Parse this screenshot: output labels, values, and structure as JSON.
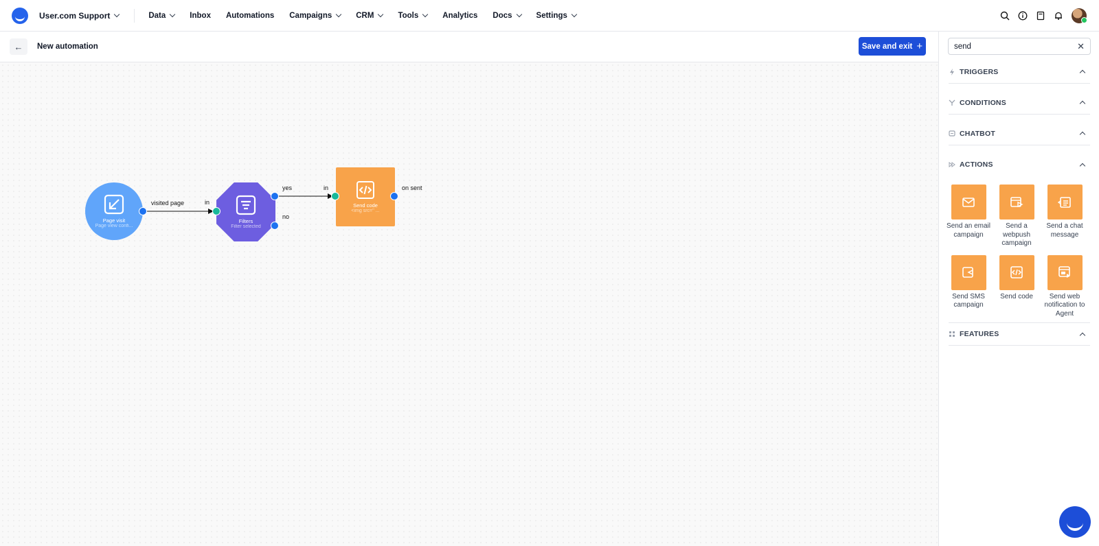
{
  "app": {
    "workspace": "User.com Support",
    "nav": [
      "Data",
      "Inbox",
      "Automations",
      "Campaigns",
      "CRM",
      "Tools",
      "Analytics",
      "Docs",
      "Settings"
    ],
    "right_icons": [
      "search-icon",
      "info-icon",
      "book-icon",
      "bell-icon",
      "avatar"
    ]
  },
  "header": {
    "back": "←",
    "title": "New automation",
    "save_label": "Save and exit",
    "save_plus": "+"
  },
  "flow": {
    "nodes": [
      {
        "id": "page-visit",
        "title": "Page visit",
        "subtitle": "Page view confi...",
        "color": "#60a5fa"
      },
      {
        "id": "filters",
        "title": "Filters",
        "subtitle": "Filter selected",
        "color": "#6d5ee0"
      },
      {
        "id": "send-code",
        "title": "Send code",
        "subtitle": "<img src='' ...",
        "color": "#f8a34a"
      }
    ],
    "edges": [
      {
        "from": "page-visit",
        "to": "filters",
        "label": "visited page",
        "in_label": "in"
      },
      {
        "from": "filters",
        "to": "send-code",
        "label": "yes",
        "in_label": "in"
      }
    ],
    "filters_no_label": "no",
    "send_code_out_label": "on sent"
  },
  "sidebar": {
    "search_value": "send",
    "clear": "✕",
    "sections": [
      {
        "name": "TRIGGERS",
        "icon": "lightning-icon"
      },
      {
        "name": "CONDITIONS",
        "icon": "branch-icon"
      },
      {
        "name": "CHATBOT",
        "icon": "chat-icon"
      },
      {
        "name": "ACTIONS",
        "icon": "fast-forward-icon"
      },
      {
        "name": "FEATURES",
        "icon": "grid-icon"
      }
    ],
    "actions": [
      {
        "label": "Send an email campaign",
        "icon": "email-icon"
      },
      {
        "label": "Send a webpush campaign",
        "icon": "webpush-icon"
      },
      {
        "label": "Send a chat message",
        "icon": "chat-message-icon"
      },
      {
        "label": "Send SMS campaign",
        "icon": "sms-icon"
      },
      {
        "label": "Send code",
        "icon": "code-icon"
      },
      {
        "label": "Send web notification to Agent",
        "icon": "web-notification-icon"
      }
    ]
  },
  "colors": {
    "primary": "#1d4ed8",
    "action_tile": "#f8a34a",
    "port_out": "#1d72f0",
    "port_in": "#18b89a"
  }
}
